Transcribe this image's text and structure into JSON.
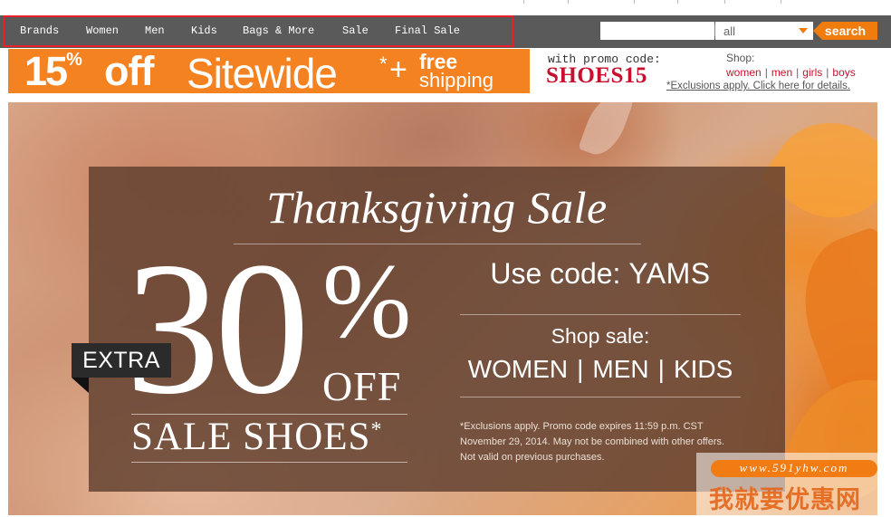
{
  "nav": {
    "items": [
      "Brands",
      "Women",
      "Men",
      "Kids",
      "Bags & More",
      "Sale",
      "Final Sale"
    ]
  },
  "search": {
    "input_value": "",
    "category_value": "all",
    "button_label": "search"
  },
  "promo": {
    "percent": "15",
    "percent_sup": "%",
    "off": "off",
    "sitewide": "Sitewide",
    "star": "*",
    "plus": "+",
    "free": "free",
    "shipping": "shipping",
    "with_code_label": "with promo code:",
    "code": "SHOES15"
  },
  "shop": {
    "label": "Shop:",
    "links": [
      "women",
      "men",
      "girls",
      "boys"
    ],
    "separator": "|",
    "exclusions": "*Exclusions apply. Click here for details."
  },
  "hero": {
    "title": "Thanksgiving Sale",
    "extra": "EXTRA",
    "number": "30",
    "percent": "%",
    "off": "OFF",
    "sale_shoes": "SALE SHOES",
    "sale_star": "*",
    "use_code_label": "Use code: ",
    "use_code_value": "YAMS",
    "shop_sale": "Shop sale:",
    "departments": [
      "WOMEN",
      "MEN",
      "KIDS"
    ],
    "dept_separator": "|",
    "fine_print": [
      "*Exclusions apply. Promo code expires 11:59 p.m. CST",
      "November 29, 2014. May not be combined with other offers.",
      "Not valid on previous purchases."
    ]
  },
  "watermark": {
    "url": "www.591yhw.com",
    "text": "我就要优惠网"
  },
  "colors": {
    "nav_bg": "#5a5a5a",
    "nav_highlight": "#e8202a",
    "accent_orange": "#f58220",
    "promo_code_red": "#c8102e",
    "overlay_brown": "#5f3e2e"
  }
}
